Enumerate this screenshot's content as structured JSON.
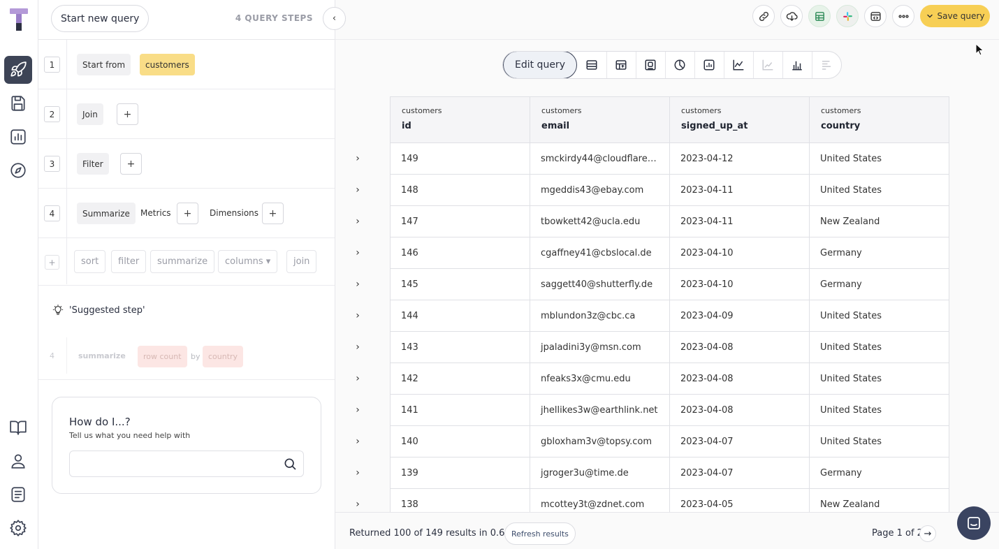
{
  "builder": {
    "start_label": "Start new query",
    "steps_count": "4 QUERY STEPS",
    "steps": [
      {
        "num": "1",
        "label": "Start from",
        "value": "customers"
      },
      {
        "num": "2",
        "label": "Join"
      },
      {
        "num": "3",
        "label": "Filter"
      },
      {
        "num": "4",
        "label": "Summarize",
        "metrics": "Metrics",
        "dimensions": "Dimensions"
      }
    ],
    "add_options": [
      "sort",
      "filter",
      "summarize",
      "columns ▾",
      "join"
    ],
    "add_plus": "+",
    "suggested": {
      "title": "'Suggested step'",
      "num": "4",
      "action": "summarize",
      "metric": "row count",
      "by": "by",
      "dimension": "country"
    },
    "help": {
      "title": "How do I...?",
      "subtitle": "Tell us what you need help with",
      "placeholder": ""
    }
  },
  "toolbar": {
    "save_label": "Save query",
    "edit_query_label": "Edit query"
  },
  "table": {
    "columns": [
      {
        "source": "customers",
        "name": "id"
      },
      {
        "source": "customers",
        "name": "email"
      },
      {
        "source": "customers",
        "name": "signed_up_at"
      },
      {
        "source": "customers",
        "name": "country"
      }
    ],
    "rows": [
      [
        "149",
        "smckirdy44@cloudflare....",
        "2023-04-12",
        "United States"
      ],
      [
        "148",
        "mgeddis43@ebay.com",
        "2023-04-11",
        "United States"
      ],
      [
        "147",
        "tbowkett42@ucla.edu",
        "2023-04-11",
        "New Zealand"
      ],
      [
        "146",
        "cgaffney41@cbslocal.de",
        "2023-04-10",
        "Germany"
      ],
      [
        "145",
        "saggett40@shutterfly.de",
        "2023-04-10",
        "Germany"
      ],
      [
        "144",
        "mblundon3z@cbc.ca",
        "2023-04-09",
        "United States"
      ],
      [
        "143",
        "jpaladini3y@msn.com",
        "2023-04-08",
        "United States"
      ],
      [
        "142",
        "nfeaks3x@cmu.edu",
        "2023-04-08",
        "United States"
      ],
      [
        "141",
        "jhellikes3w@earthlink.net",
        "2023-04-08",
        "United States"
      ],
      [
        "140",
        "gbloxham3v@topsy.com",
        "2023-04-07",
        "United States"
      ],
      [
        "139",
        "jgroger3u@time.de",
        "2023-04-07",
        "Germany"
      ],
      [
        "138",
        "mcottey3t@zdnet.com",
        "2023-04-05",
        "New Zealand"
      ]
    ]
  },
  "footer": {
    "result_text": "Returned 100 of 149 results in 0.60s",
    "refresh_label": "Refresh results",
    "page_text": "Page 1 of 2"
  },
  "colors": {
    "accent_yellow": "#f7cf55",
    "chip_yellow": "#f9dd87",
    "rail_active": "#3d4456",
    "logo_purple": "#b49ad8"
  }
}
